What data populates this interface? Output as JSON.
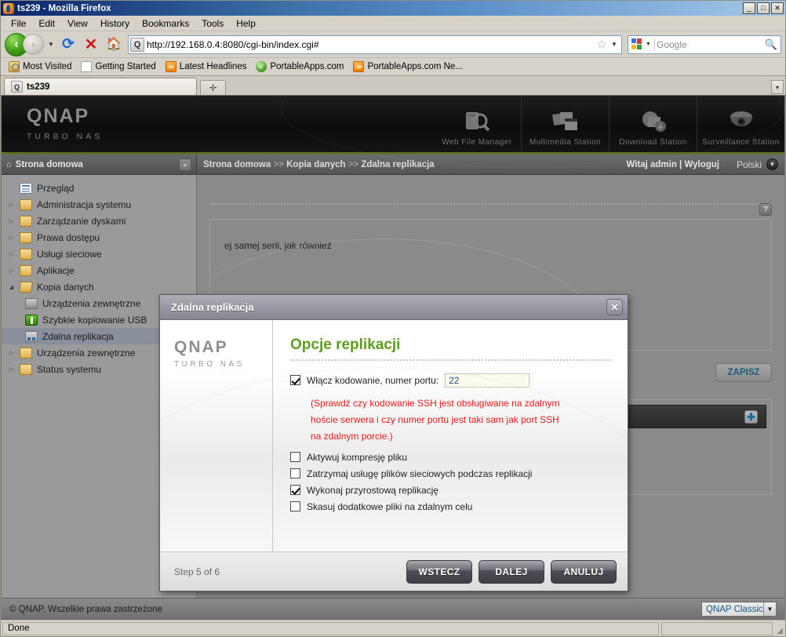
{
  "browser": {
    "title": "ts239 - Mozilla Firefox",
    "window_buttons": {
      "minimize": "_",
      "maximize": "□",
      "close": "✕"
    },
    "menu": [
      "File",
      "Edit",
      "View",
      "History",
      "Bookmarks",
      "Tools",
      "Help"
    ],
    "url": "http://192.168.0.4:8080/cgi-bin/index.cgi#",
    "search_placeholder": "Google",
    "bookmarks": [
      {
        "label": "Most Visited",
        "icon": "folder-visited-icon"
      },
      {
        "label": "Getting Started",
        "icon": "page-icon"
      },
      {
        "label": "Latest Headlines",
        "icon": "rss-icon"
      },
      {
        "label": "PortableApps.com",
        "icon": "green-check-icon"
      },
      {
        "label": "PortableApps.com Ne...",
        "icon": "rss-icon"
      }
    ],
    "tab": {
      "label": "ts239"
    },
    "new_tab_label": "✛",
    "tabstrip_overflow": "▾",
    "status": "Done"
  },
  "qnap": {
    "logo": {
      "word": "QNAP",
      "sub": "TURBO NAS"
    },
    "nav": [
      {
        "label": "Web File Manager",
        "icon": "file-search-icon"
      },
      {
        "label": "Multimedia Station",
        "icon": "multimedia-icon"
      },
      {
        "label": "Download Station",
        "icon": "download-icon"
      },
      {
        "label": "Surveillance Station",
        "icon": "camera-icon"
      }
    ]
  },
  "crumbbar": {
    "home_label": "Strona domowa",
    "collapse_label": "«",
    "path": [
      "Strona domowa",
      "Kopia danych",
      "Zdalna replikacja"
    ],
    "path_separator": ">>",
    "user_text": "Witaj admin | Wyloguj",
    "language": "Polski"
  },
  "sidebar": {
    "items": [
      {
        "label": "Przegląd",
        "icon": "overview-icon",
        "arrow": "",
        "indent": 0,
        "selected": false
      },
      {
        "label": "Administracja systemu",
        "icon": "folder-icon",
        "arrow": "▷",
        "indent": 0,
        "selected": false
      },
      {
        "label": "Zarządzanie dyskami",
        "icon": "folder-icon",
        "arrow": "▷",
        "indent": 0,
        "selected": false
      },
      {
        "label": "Prawa dostępu",
        "icon": "folder-icon",
        "arrow": "▷",
        "indent": 0,
        "selected": false
      },
      {
        "label": "Usługi sieciowe",
        "icon": "folder-icon",
        "arrow": "▷",
        "indent": 0,
        "selected": false
      },
      {
        "label": "Aplikacje",
        "icon": "folder-icon",
        "arrow": "▷",
        "indent": 0,
        "selected": false
      },
      {
        "label": "Kopia danych",
        "icon": "folder-open-icon",
        "arrow": "◢",
        "indent": 0,
        "selected": false
      },
      {
        "label": "Urządzenia zewnętrzne",
        "icon": "external-device-icon",
        "arrow": "",
        "indent": 1,
        "selected": false
      },
      {
        "label": "Szybkie kopiowanie USB",
        "icon": "usb-icon",
        "arrow": "",
        "indent": 1,
        "selected": false
      },
      {
        "label": "Zdalna replikacja",
        "icon": "replication-icon",
        "arrow": "",
        "indent": 1,
        "selected": true
      },
      {
        "label": "Urządzenia zewnętrzne",
        "icon": "folder-icon",
        "arrow": "▷",
        "indent": 0,
        "selected": false
      },
      {
        "label": "Status systemu",
        "icon": "folder-icon",
        "arrow": "▷",
        "indent": 0,
        "selected": false
      }
    ]
  },
  "main": {
    "help_label": "?",
    "box_text": "ej samej serii, jak również",
    "save_label": "ZAPISZ",
    "add_label": "✚"
  },
  "page_footer": {
    "copyright": "© QNAP, Wszelkie prawa zastrzeżone",
    "skin": "QNAP Classic",
    "skin_caret": "▼"
  },
  "modal": {
    "title": "Zdalna replikacja",
    "close_label": "✕",
    "logo": {
      "word": "QNAP",
      "sub": "TURBO NAS"
    },
    "heading": "Opcje replikacji",
    "port_row": {
      "label": "Włącz kodowanie, numer portu:",
      "checked": true,
      "port_value": "22"
    },
    "warning": "(Sprawdź czy kodowanie SSH jest obsługiwane na zdalnym hoście serwera i czy numer portu jest taki sam jak port SSH na zdalnym porcie.)",
    "options": [
      {
        "label": "Aktywuj kompresję pliku",
        "checked": false
      },
      {
        "label": "Zatrzymaj usługę plików sieciowych podczas replikacji",
        "checked": false
      },
      {
        "label": "Wykonaj przyrostową replikację",
        "checked": true
      },
      {
        "label": "Skasuj dodatkowe pliki na zdalnym celu",
        "checked": false
      }
    ],
    "step_text": "Step 5 of 6",
    "buttons": {
      "back": "WSTECZ",
      "next": "DALEJ",
      "cancel": "ANULUJ"
    }
  },
  "colors": {
    "accent_green": "#5e9e1e",
    "warning_red": "#e21b1b",
    "link_blue": "#1b5c7e",
    "titlebar_blue": "#0a246a"
  }
}
